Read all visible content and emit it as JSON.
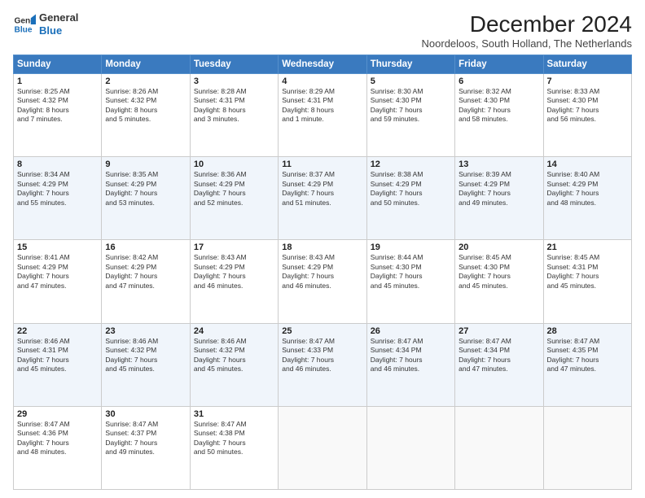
{
  "logo": {
    "line1": "General",
    "line2": "Blue"
  },
  "title": "December 2024",
  "subtitle": "Noordeloos, South Holland, The Netherlands",
  "days_header": [
    "Sunday",
    "Monday",
    "Tuesday",
    "Wednesday",
    "Thursday",
    "Friday",
    "Saturday"
  ],
  "weeks": [
    [
      {
        "day": "1",
        "text": "Sunrise: 8:25 AM\nSunset: 4:32 PM\nDaylight: 8 hours\nand 7 minutes."
      },
      {
        "day": "2",
        "text": "Sunrise: 8:26 AM\nSunset: 4:32 PM\nDaylight: 8 hours\nand 5 minutes."
      },
      {
        "day": "3",
        "text": "Sunrise: 8:28 AM\nSunset: 4:31 PM\nDaylight: 8 hours\nand 3 minutes."
      },
      {
        "day": "4",
        "text": "Sunrise: 8:29 AM\nSunset: 4:31 PM\nDaylight: 8 hours\nand 1 minute."
      },
      {
        "day": "5",
        "text": "Sunrise: 8:30 AM\nSunset: 4:30 PM\nDaylight: 7 hours\nand 59 minutes."
      },
      {
        "day": "6",
        "text": "Sunrise: 8:32 AM\nSunset: 4:30 PM\nDaylight: 7 hours\nand 58 minutes."
      },
      {
        "day": "7",
        "text": "Sunrise: 8:33 AM\nSunset: 4:30 PM\nDaylight: 7 hours\nand 56 minutes."
      }
    ],
    [
      {
        "day": "8",
        "text": "Sunrise: 8:34 AM\nSunset: 4:29 PM\nDaylight: 7 hours\nand 55 minutes."
      },
      {
        "day": "9",
        "text": "Sunrise: 8:35 AM\nSunset: 4:29 PM\nDaylight: 7 hours\nand 53 minutes."
      },
      {
        "day": "10",
        "text": "Sunrise: 8:36 AM\nSunset: 4:29 PM\nDaylight: 7 hours\nand 52 minutes."
      },
      {
        "day": "11",
        "text": "Sunrise: 8:37 AM\nSunset: 4:29 PM\nDaylight: 7 hours\nand 51 minutes."
      },
      {
        "day": "12",
        "text": "Sunrise: 8:38 AM\nSunset: 4:29 PM\nDaylight: 7 hours\nand 50 minutes."
      },
      {
        "day": "13",
        "text": "Sunrise: 8:39 AM\nSunset: 4:29 PM\nDaylight: 7 hours\nand 49 minutes."
      },
      {
        "day": "14",
        "text": "Sunrise: 8:40 AM\nSunset: 4:29 PM\nDaylight: 7 hours\nand 48 minutes."
      }
    ],
    [
      {
        "day": "15",
        "text": "Sunrise: 8:41 AM\nSunset: 4:29 PM\nDaylight: 7 hours\nand 47 minutes."
      },
      {
        "day": "16",
        "text": "Sunrise: 8:42 AM\nSunset: 4:29 PM\nDaylight: 7 hours\nand 47 minutes."
      },
      {
        "day": "17",
        "text": "Sunrise: 8:43 AM\nSunset: 4:29 PM\nDaylight: 7 hours\nand 46 minutes."
      },
      {
        "day": "18",
        "text": "Sunrise: 8:43 AM\nSunset: 4:29 PM\nDaylight: 7 hours\nand 46 minutes."
      },
      {
        "day": "19",
        "text": "Sunrise: 8:44 AM\nSunset: 4:30 PM\nDaylight: 7 hours\nand 45 minutes."
      },
      {
        "day": "20",
        "text": "Sunrise: 8:45 AM\nSunset: 4:30 PM\nDaylight: 7 hours\nand 45 minutes."
      },
      {
        "day": "21",
        "text": "Sunrise: 8:45 AM\nSunset: 4:31 PM\nDaylight: 7 hours\nand 45 minutes."
      }
    ],
    [
      {
        "day": "22",
        "text": "Sunrise: 8:46 AM\nSunset: 4:31 PM\nDaylight: 7 hours\nand 45 minutes."
      },
      {
        "day": "23",
        "text": "Sunrise: 8:46 AM\nSunset: 4:32 PM\nDaylight: 7 hours\nand 45 minutes."
      },
      {
        "day": "24",
        "text": "Sunrise: 8:46 AM\nSunset: 4:32 PM\nDaylight: 7 hours\nand 45 minutes."
      },
      {
        "day": "25",
        "text": "Sunrise: 8:47 AM\nSunset: 4:33 PM\nDaylight: 7 hours\nand 46 minutes."
      },
      {
        "day": "26",
        "text": "Sunrise: 8:47 AM\nSunset: 4:34 PM\nDaylight: 7 hours\nand 46 minutes."
      },
      {
        "day": "27",
        "text": "Sunrise: 8:47 AM\nSunset: 4:34 PM\nDaylight: 7 hours\nand 47 minutes."
      },
      {
        "day": "28",
        "text": "Sunrise: 8:47 AM\nSunset: 4:35 PM\nDaylight: 7 hours\nand 47 minutes."
      }
    ],
    [
      {
        "day": "29",
        "text": "Sunrise: 8:47 AM\nSunset: 4:36 PM\nDaylight: 7 hours\nand 48 minutes."
      },
      {
        "day": "30",
        "text": "Sunrise: 8:47 AM\nSunset: 4:37 PM\nDaylight: 7 hours\nand 49 minutes."
      },
      {
        "day": "31",
        "text": "Sunrise: 8:47 AM\nSunset: 4:38 PM\nDaylight: 7 hours\nand 50 minutes."
      },
      {
        "day": "",
        "text": ""
      },
      {
        "day": "",
        "text": ""
      },
      {
        "day": "",
        "text": ""
      },
      {
        "day": "",
        "text": ""
      }
    ]
  ]
}
